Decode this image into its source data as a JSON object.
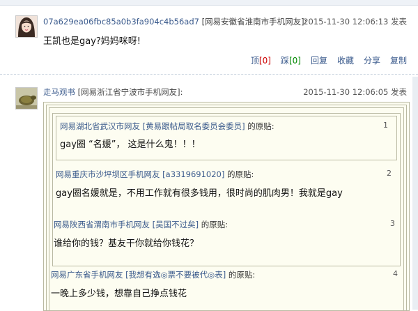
{
  "posts": [
    {
      "username": "07a629ea06fbc85a0b3fa904c4b56ad7",
      "location": "[网易安徽省淮南市手机网友]:",
      "timestamp": "2015-11-30 12:06:13 发表",
      "body": "王凯也是gay?妈妈咪呀!",
      "avatar_icon": "user-photo-avatar",
      "actions": {
        "up_label": "顶",
        "up_count": "[0]",
        "down_label": "踩",
        "down_count": "[0]",
        "reply": "回复",
        "favorite": "收藏",
        "share": "分享",
        "copy": "复制"
      }
    },
    {
      "username": "走马观书",
      "location": "[网易浙江省宁波市手机网友]:",
      "timestamp": "2015-11-30 12:06:05 发表",
      "avatar_icon": "turtle-avatar",
      "quotes": [
        {
          "loc": "网易湖北省武汉市网友",
          "sig": "[黄易跟帖局取名委员会委员]",
          "suffix": "的原贴:",
          "num": "1",
          "text": "gay圈 “名媛”， 这是什么鬼！！！"
        },
        {
          "loc": "网易重庆市沙坪坝区手机网友",
          "sig": "[a3319691020]",
          "suffix": "的原贴:",
          "num": "2",
          "text": "gay圈名媛就是，不用工作就有很多钱用，很时尚的肌肉男！我就是gay"
        },
        {
          "loc": "网易陕西省渭南市手机网友",
          "sig": "[吴国不过矣]",
          "suffix": "的原贴:",
          "num": "3",
          "text": "谁给你的钱？基友干你就给你钱花？"
        },
        {
          "loc": "网易广东省手机网友",
          "sig": "[我想有选◎票不要被代◎表]",
          "suffix": "的原贴:",
          "num": "4",
          "text": "一晚上多少钱，想靠自己挣点钱花"
        }
      ]
    }
  ]
}
